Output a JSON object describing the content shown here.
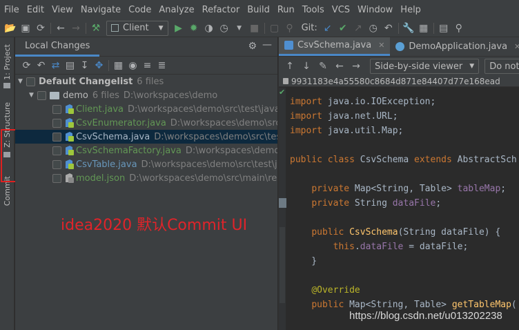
{
  "menu": [
    "File",
    "Edit",
    "View",
    "Navigate",
    "Code",
    "Analyze",
    "Refactor",
    "Build",
    "Run",
    "Tools",
    "VCS",
    "Window",
    "Help"
  ],
  "toolbar": {
    "run_config": "Client",
    "git_label": "Git:"
  },
  "left_strip": {
    "project_tab": "1: Project",
    "structure_tab": "Z: Structure",
    "commit_tab": "Commit"
  },
  "panel": {
    "tab_label": "Local Changes"
  },
  "tree": {
    "changelist": {
      "name": "Default Changelist",
      "count": "6 files"
    },
    "folder": {
      "name": "demo",
      "count": "6 files",
      "path": "D:\\workspaces\\demo"
    },
    "files": [
      {
        "name": "Client.java",
        "path": "D:\\workspaces\\demo\\src\\test\\java\\com"
      },
      {
        "name": "CsvEnumerator.java",
        "path": "D:\\workspaces\\demo\\src\\test"
      },
      {
        "name": "CsvSchema.java",
        "path": "D:\\workspaces\\demo\\src\\test\\jav"
      },
      {
        "name": "CsvSchemaFactory.java",
        "path": "D:\\workspaces\\demo\\src\\te"
      },
      {
        "name": "CsvTable.java",
        "path": "D:\\workspaces\\demo\\src\\test\\java\\"
      },
      {
        "name": "model.json",
        "path": "D:\\workspaces\\demo\\src\\main\\resou"
      }
    ]
  },
  "annotation": "idea2020 默认Commit UI",
  "editor": {
    "tabs": [
      "CsvSchema.java",
      "DemoApplication.java"
    ],
    "viewer": "Side-by-side viewer",
    "ignore": "Do not",
    "hash": "9931183e4a55580c8684d871e84407d77e168ead"
  },
  "colors": {
    "accent": "#4a88c7",
    "annotation_red": "#e02020",
    "selection": "#0d293e"
  },
  "watermark": "https://blog.csdn.net/u013202238"
}
